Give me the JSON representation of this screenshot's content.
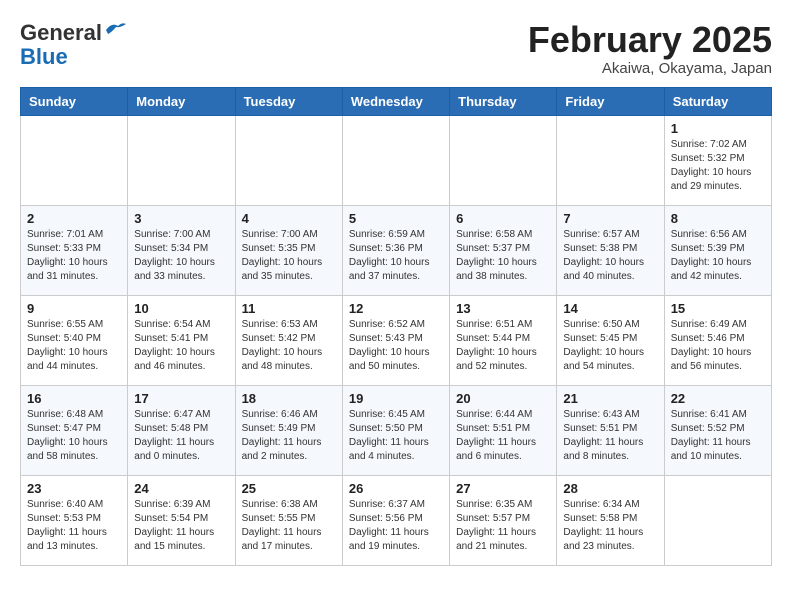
{
  "header": {
    "logo": {
      "line1": "General",
      "line2": "Blue"
    },
    "month_title": "February 2025",
    "location": "Akaiwa, Okayama, Japan"
  },
  "weekdays": [
    "Sunday",
    "Monday",
    "Tuesday",
    "Wednesday",
    "Thursday",
    "Friday",
    "Saturday"
  ],
  "weeks": [
    [
      {
        "day": "",
        "info": ""
      },
      {
        "day": "",
        "info": ""
      },
      {
        "day": "",
        "info": ""
      },
      {
        "day": "",
        "info": ""
      },
      {
        "day": "",
        "info": ""
      },
      {
        "day": "",
        "info": ""
      },
      {
        "day": "1",
        "info": "Sunrise: 7:02 AM\nSunset: 5:32 PM\nDaylight: 10 hours\nand 29 minutes."
      }
    ],
    [
      {
        "day": "2",
        "info": "Sunrise: 7:01 AM\nSunset: 5:33 PM\nDaylight: 10 hours\nand 31 minutes."
      },
      {
        "day": "3",
        "info": "Sunrise: 7:00 AM\nSunset: 5:34 PM\nDaylight: 10 hours\nand 33 minutes."
      },
      {
        "day": "4",
        "info": "Sunrise: 7:00 AM\nSunset: 5:35 PM\nDaylight: 10 hours\nand 35 minutes."
      },
      {
        "day": "5",
        "info": "Sunrise: 6:59 AM\nSunset: 5:36 PM\nDaylight: 10 hours\nand 37 minutes."
      },
      {
        "day": "6",
        "info": "Sunrise: 6:58 AM\nSunset: 5:37 PM\nDaylight: 10 hours\nand 38 minutes."
      },
      {
        "day": "7",
        "info": "Sunrise: 6:57 AM\nSunset: 5:38 PM\nDaylight: 10 hours\nand 40 minutes."
      },
      {
        "day": "8",
        "info": "Sunrise: 6:56 AM\nSunset: 5:39 PM\nDaylight: 10 hours\nand 42 minutes."
      }
    ],
    [
      {
        "day": "9",
        "info": "Sunrise: 6:55 AM\nSunset: 5:40 PM\nDaylight: 10 hours\nand 44 minutes."
      },
      {
        "day": "10",
        "info": "Sunrise: 6:54 AM\nSunset: 5:41 PM\nDaylight: 10 hours\nand 46 minutes."
      },
      {
        "day": "11",
        "info": "Sunrise: 6:53 AM\nSunset: 5:42 PM\nDaylight: 10 hours\nand 48 minutes."
      },
      {
        "day": "12",
        "info": "Sunrise: 6:52 AM\nSunset: 5:43 PM\nDaylight: 10 hours\nand 50 minutes."
      },
      {
        "day": "13",
        "info": "Sunrise: 6:51 AM\nSunset: 5:44 PM\nDaylight: 10 hours\nand 52 minutes."
      },
      {
        "day": "14",
        "info": "Sunrise: 6:50 AM\nSunset: 5:45 PM\nDaylight: 10 hours\nand 54 minutes."
      },
      {
        "day": "15",
        "info": "Sunrise: 6:49 AM\nSunset: 5:46 PM\nDaylight: 10 hours\nand 56 minutes."
      }
    ],
    [
      {
        "day": "16",
        "info": "Sunrise: 6:48 AM\nSunset: 5:47 PM\nDaylight: 10 hours\nand 58 minutes."
      },
      {
        "day": "17",
        "info": "Sunrise: 6:47 AM\nSunset: 5:48 PM\nDaylight: 11 hours\nand 0 minutes."
      },
      {
        "day": "18",
        "info": "Sunrise: 6:46 AM\nSunset: 5:49 PM\nDaylight: 11 hours\nand 2 minutes."
      },
      {
        "day": "19",
        "info": "Sunrise: 6:45 AM\nSunset: 5:50 PM\nDaylight: 11 hours\nand 4 minutes."
      },
      {
        "day": "20",
        "info": "Sunrise: 6:44 AM\nSunset: 5:51 PM\nDaylight: 11 hours\nand 6 minutes."
      },
      {
        "day": "21",
        "info": "Sunrise: 6:43 AM\nSunset: 5:51 PM\nDaylight: 11 hours\nand 8 minutes."
      },
      {
        "day": "22",
        "info": "Sunrise: 6:41 AM\nSunset: 5:52 PM\nDaylight: 11 hours\nand 10 minutes."
      }
    ],
    [
      {
        "day": "23",
        "info": "Sunrise: 6:40 AM\nSunset: 5:53 PM\nDaylight: 11 hours\nand 13 minutes."
      },
      {
        "day": "24",
        "info": "Sunrise: 6:39 AM\nSunset: 5:54 PM\nDaylight: 11 hours\nand 15 minutes."
      },
      {
        "day": "25",
        "info": "Sunrise: 6:38 AM\nSunset: 5:55 PM\nDaylight: 11 hours\nand 17 minutes."
      },
      {
        "day": "26",
        "info": "Sunrise: 6:37 AM\nSunset: 5:56 PM\nDaylight: 11 hours\nand 19 minutes."
      },
      {
        "day": "27",
        "info": "Sunrise: 6:35 AM\nSunset: 5:57 PM\nDaylight: 11 hours\nand 21 minutes."
      },
      {
        "day": "28",
        "info": "Sunrise: 6:34 AM\nSunset: 5:58 PM\nDaylight: 11 hours\nand 23 minutes."
      },
      {
        "day": "",
        "info": ""
      }
    ]
  ]
}
